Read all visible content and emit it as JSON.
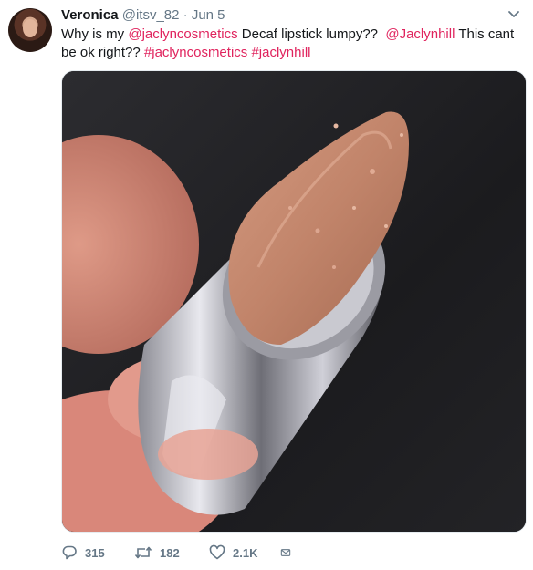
{
  "tweet": {
    "user": {
      "name": "Veronica",
      "handle": "@itsv_82",
      "separator": "·",
      "date": "Jun 5"
    },
    "text_parts": [
      {
        "kind": "text",
        "value": "Why is my "
      },
      {
        "kind": "mention",
        "value": "@jaclyncosmetics"
      },
      {
        "kind": "text",
        "value": " Decaf lipstick lumpy??  "
      },
      {
        "kind": "mention",
        "value": "@Jaclynhill"
      },
      {
        "kind": "text",
        "value": " This cant be ok right?? "
      },
      {
        "kind": "hashtag",
        "value": "#jaclyncosmetics"
      },
      {
        "kind": "text",
        "value": " "
      },
      {
        "kind": "hashtag",
        "value": "#jaclynhill"
      }
    ],
    "actions": {
      "replies": "315",
      "retweets": "182",
      "likes": "2.1K"
    },
    "icons": {
      "menu": "chevron-down-icon",
      "reply": "reply-icon",
      "retweet": "retweet-icon",
      "like": "heart-icon",
      "dm": "envelope-icon"
    },
    "colors": {
      "link": "#e0245e",
      "text": "#14171a",
      "muted": "#657786"
    }
  }
}
